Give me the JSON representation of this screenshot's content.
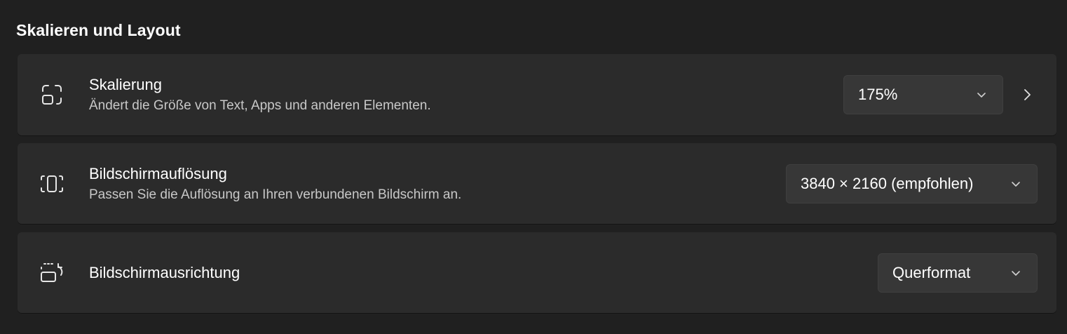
{
  "section": {
    "title": "Skalieren und Layout"
  },
  "rows": [
    {
      "icon": "scale-icon",
      "title": "Skalierung",
      "description": "Ändert die Größe von Text, Apps und anderen Elementen.",
      "value": "175%"
    },
    {
      "icon": "resolution-icon",
      "title": "Bildschirmauflösung",
      "description": "Passen Sie die Auflösung an Ihren verbundenen Bildschirm an.",
      "value": "3840 × 2160 (empfohlen)"
    },
    {
      "icon": "orientation-icon",
      "title": "Bildschirmausrichtung",
      "value": "Querformat"
    }
  ],
  "colors": {
    "background": "#202020",
    "card": "#2b2b2b",
    "dropdown": "#373737",
    "text": "#ffffff",
    "secondary_text": "#c8c8c8"
  }
}
